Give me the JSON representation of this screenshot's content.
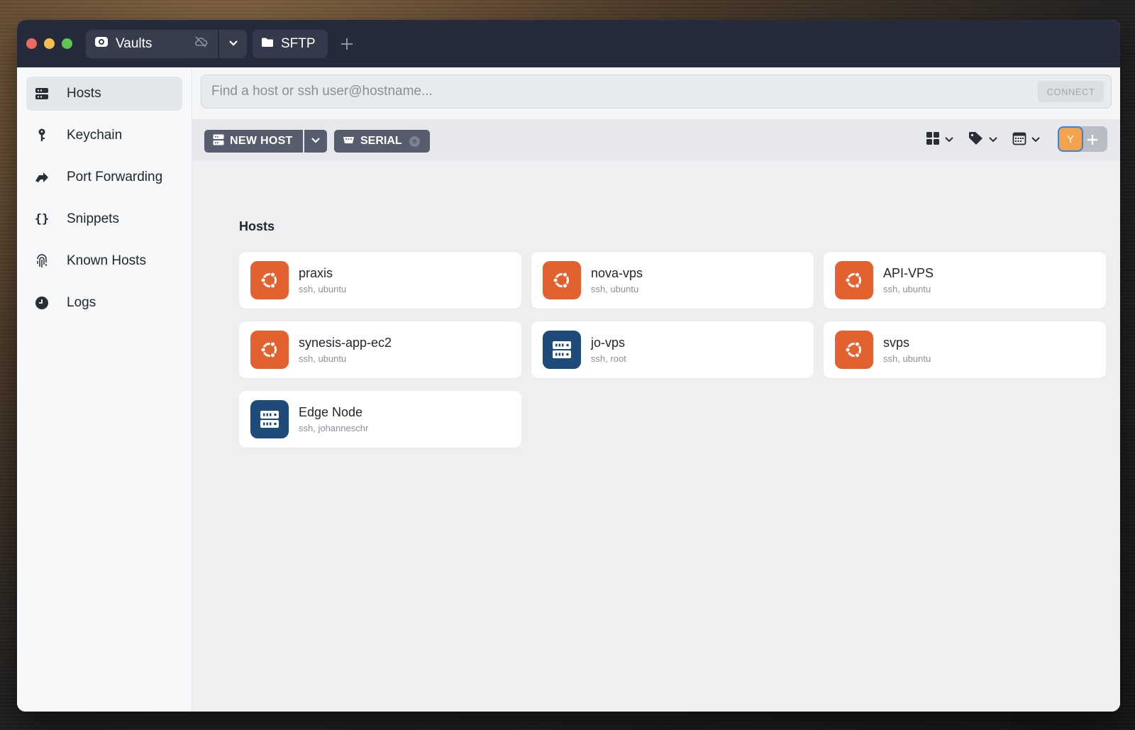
{
  "titlebar": {
    "vault_tab": "Vaults",
    "sftp_tab": "SFTP"
  },
  "sidebar": {
    "items": [
      {
        "label": "Hosts",
        "icon": "hosts-icon"
      },
      {
        "label": "Keychain",
        "icon": "key-icon"
      },
      {
        "label": "Port Forwarding",
        "icon": "port-forwarding-icon"
      },
      {
        "label": "Snippets",
        "icon": "braces-icon"
      },
      {
        "label": "Known Hosts",
        "icon": "fingerprint-icon"
      },
      {
        "label": "Logs",
        "icon": "clock-icon"
      }
    ]
  },
  "search": {
    "placeholder": "Find a host or ssh user@hostname...",
    "connect_label": "CONNECT"
  },
  "toolbar": {
    "new_host_label": "NEW HOST",
    "serial_label": "SERIAL",
    "avatar_initial": "Y"
  },
  "main": {
    "section_title": "Hosts",
    "hosts": [
      {
        "name": "praxis",
        "sub": "ssh, ubuntu",
        "icon": "ubuntu-icon"
      },
      {
        "name": "nova-vps",
        "sub": "ssh, ubuntu",
        "icon": "ubuntu-icon"
      },
      {
        "name": "API-VPS",
        "sub": "ssh, ubuntu",
        "icon": "ubuntu-icon"
      },
      {
        "name": "synesis-app-ec2",
        "sub": "ssh, ubuntu",
        "icon": "ubuntu-icon"
      },
      {
        "name": "jo-vps",
        "sub": "ssh, root",
        "icon": "server-icon"
      },
      {
        "name": "svps",
        "sub": "ssh, ubuntu",
        "icon": "ubuntu-icon"
      },
      {
        "name": "Edge Node",
        "sub": "ssh, johanneschr",
        "icon": "server-icon"
      }
    ]
  },
  "colors": {
    "titlebar": "#262b3b",
    "ubuntu_orange": "#e2612f",
    "server_blue": "#1e4b7a",
    "button_gray": "#575d6d",
    "avatar": "#f3a34c"
  }
}
